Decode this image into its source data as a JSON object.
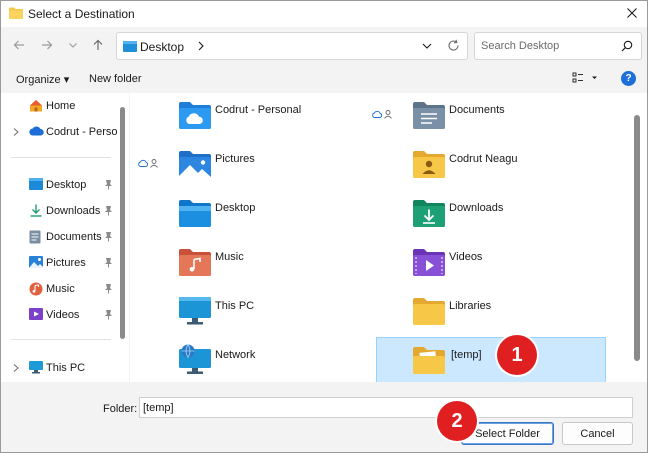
{
  "window": {
    "title": "Select a Destination"
  },
  "nav": {
    "address_location": "Desktop",
    "search_placeholder": "Search Desktop"
  },
  "toolbar": {
    "organize_label": "Organize ▾",
    "new_folder_label": "New folder",
    "help_label": "?"
  },
  "sidebar": {
    "items": [
      {
        "label": "Home",
        "icon": "home-icon",
        "expandable": false,
        "pinned": false
      },
      {
        "label": "Codrut - Personal",
        "icon": "onedrive-cloud-icon",
        "expandable": true,
        "pinned": false
      },
      {
        "label": "Desktop",
        "icon": "desktop-folder-icon",
        "expandable": false,
        "pinned": true
      },
      {
        "label": "Downloads",
        "icon": "downloads-icon",
        "expandable": false,
        "pinned": true
      },
      {
        "label": "Documents",
        "icon": "documents-icon",
        "expandable": false,
        "pinned": true
      },
      {
        "label": "Pictures",
        "icon": "pictures-icon",
        "expandable": false,
        "pinned": true
      },
      {
        "label": "Music",
        "icon": "music-icon",
        "expandable": false,
        "pinned": true
      },
      {
        "label": "Videos",
        "icon": "videos-icon",
        "expandable": false,
        "pinned": true
      },
      {
        "label": "This PC",
        "icon": "this-pc-icon",
        "expandable": true,
        "pinned": false
      }
    ]
  },
  "content": {
    "tiles": [
      {
        "label": "Codrut - Personal",
        "icon": "onedrive-folder-icon",
        "status": ""
      },
      {
        "label": "Documents",
        "icon": "documents-folder-icon",
        "status": "cloud-person"
      },
      {
        "label": "Pictures",
        "icon": "pictures-folder-icon",
        "status": "cloud-person"
      },
      {
        "label": "Codrut Neagu",
        "icon": "user-folder-icon",
        "status": ""
      },
      {
        "label": "Desktop",
        "icon": "desktop-folder-icon",
        "status": ""
      },
      {
        "label": "Downloads",
        "icon": "downloads-folder-icon",
        "status": ""
      },
      {
        "label": "Music",
        "icon": "music-folder-icon",
        "status": ""
      },
      {
        "label": "Videos",
        "icon": "videos-folder-icon",
        "status": ""
      },
      {
        "label": "This PC",
        "icon": "this-pc-icon",
        "status": ""
      },
      {
        "label": "Libraries",
        "icon": "libraries-folder-icon",
        "status": ""
      },
      {
        "label": "Network",
        "icon": "network-icon",
        "status": ""
      },
      {
        "label": "[temp]",
        "icon": "temp-folder-icon",
        "status": "",
        "selected": true
      }
    ]
  },
  "bottom": {
    "folder_label": "Folder:",
    "folder_value": "[temp]",
    "select_button": "Select Folder",
    "cancel_button": "Cancel"
  },
  "markers": {
    "one": "1",
    "two": "2"
  },
  "colors": {
    "accent": "#1e6fd9",
    "selection": "#cce8ff",
    "marker": "#e02020",
    "folder_yellow": "#f6c84a"
  }
}
